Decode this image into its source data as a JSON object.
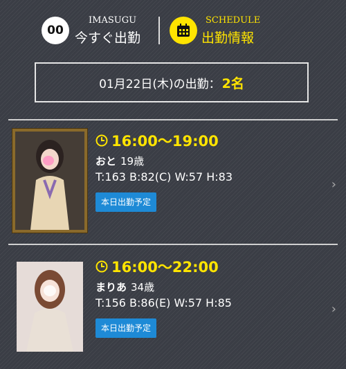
{
  "header": {
    "imasugu": {
      "badge": "00",
      "sub": "IMASUGU",
      "label": "今すぐ出勤"
    },
    "schedule": {
      "sub": "SCHEDULE",
      "label": "出勤情報"
    }
  },
  "date_banner": {
    "text": "01月22日(木)の出勤：",
    "count": "2名"
  },
  "cards": [
    {
      "time": "16:00〜19:00",
      "name": "おと",
      "age": "19歳",
      "stats": "T:163 B:82(C) W:57 H:83",
      "badge": "本日出勤予定"
    },
    {
      "time": "16:00〜22:00",
      "name": "まりあ",
      "age": "34歳",
      "stats": "T:156 B:86(E) W:57 H:85",
      "badge": "本日出勤予定"
    }
  ],
  "colors": {
    "accent_yellow": "#ffe400",
    "badge_blue": "#1e8ad6",
    "bg": "#3a3d45"
  }
}
